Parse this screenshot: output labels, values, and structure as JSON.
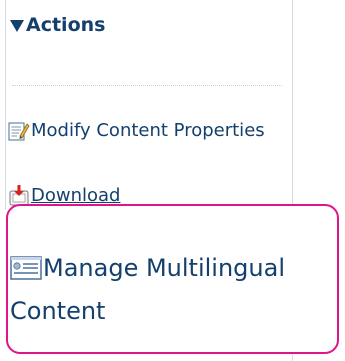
{
  "panel": {
    "title": "Actions",
    "collapse_icon": "triangle-down-icon"
  },
  "actions": {
    "modify": {
      "label": "Modify Content Properties",
      "icon": "edit-document-icon"
    },
    "download": {
      "label": "Download",
      "icon": "download-icon"
    },
    "manage_multilingual": {
      "label": "Manage Multilingual Content",
      "icon": "multilingual-card-icon"
    }
  },
  "colors": {
    "link": "#13406d",
    "highlight_border": "#e0158a",
    "panel_border": "#d4dce6"
  }
}
